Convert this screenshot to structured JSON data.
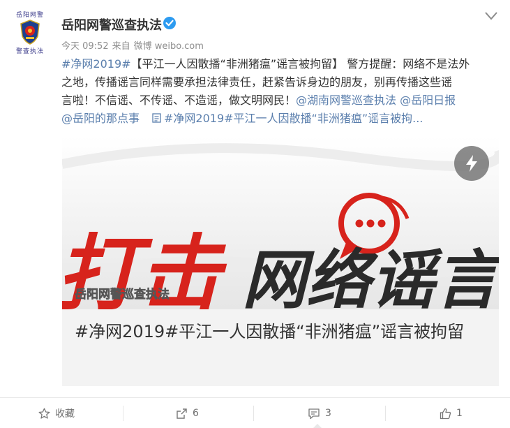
{
  "header": {
    "avatar_top_text": "岳阳网警",
    "avatar_bottom_text": "警查执法",
    "username": "岳阳网警巡查执法",
    "verified_icon": "verified-icon",
    "menu_icon": "chevron-down-icon"
  },
  "meta": {
    "time": "今天 09:52",
    "from": "来自",
    "source": "微博 weibo.com"
  },
  "post": {
    "topic1": "#净网2019#",
    "line1_rest": "【平江一人因散播“非洲猪瘟”谣言被拘留】 警方提醒：网络不是法外",
    "line2": "之地，传播谣言同样需要承担法律责任，赶紧告诉身边的朋友，别再传播这些谣",
    "line3": "言啦！不信谣、不传谣、不造谣，做文明网民！",
    "mention1": "@湖南网警巡查执法",
    "mention2": "@岳阳日报",
    "mention3": "@岳阳的那点事",
    "article_link": "#净网2019#平江一人因散播“非洲猪瘟”谣言被拘..."
  },
  "card": {
    "image_big_left": "打击",
    "image_big_right": "网络谣言",
    "image_watermark": "岳阳网警巡查执法",
    "title": "#净网2019#平江一人因散播“非洲猪瘟”谣言被拘留",
    "flash_icon": "lightning-icon"
  },
  "actions": {
    "favorite_label": "收藏",
    "forward_count": "6",
    "comment_count": "3",
    "like_count": "1"
  },
  "colors": {
    "link": "#5b7fad",
    "text": "#333333",
    "meta": "#8e8e8e",
    "card_bg": "#f3f3f3",
    "red": "#d7231c",
    "verified": "#2d9bf0"
  }
}
